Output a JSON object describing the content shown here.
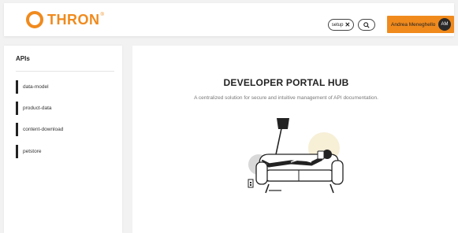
{
  "header": {
    "logo_text": "THRON",
    "logo_tm": "®",
    "search_chip_label": "setup",
    "user_name": "Andrea Meneghello",
    "avatar_initials": "AM"
  },
  "sidebar": {
    "title": "APIs",
    "items": [
      {
        "label": "data-model"
      },
      {
        "label": "product-data"
      },
      {
        "label": "content-download"
      },
      {
        "label": "petstore"
      }
    ]
  },
  "main": {
    "title": "DEVELOPER PORTAL HUB",
    "subtitle": "A centralized solution for secure and intuitive management of API documentation."
  },
  "colors": {
    "accent": "#f08a1d",
    "dark": "#222222",
    "illustration_highlight": "#f7efd6",
    "illustration_shadow": "#d9d9d9"
  }
}
